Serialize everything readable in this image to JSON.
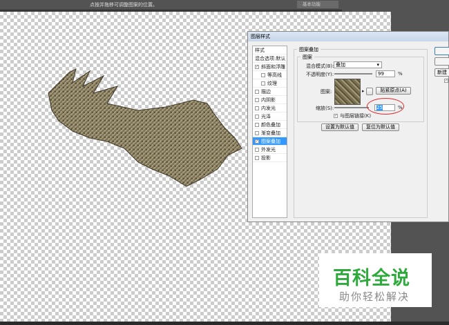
{
  "topbar": {
    "hint": "点按并拖移可调整图案的位置。",
    "workspace": "基本功能"
  },
  "dialog": {
    "title": "图层样式",
    "styles_header": "样式",
    "blend_options": "混合选项:默认",
    "styles": [
      {
        "label": "斜面和浮雕",
        "checked": true,
        "sub": false
      },
      {
        "label": "等高线",
        "checked": false,
        "sub": true
      },
      {
        "label": "纹理",
        "checked": false,
        "sub": true
      },
      {
        "label": "描边",
        "checked": false,
        "sub": false
      },
      {
        "label": "内阴影",
        "checked": false,
        "sub": false
      },
      {
        "label": "内发光",
        "checked": false,
        "sub": false
      },
      {
        "label": "光泽",
        "checked": false,
        "sub": false
      },
      {
        "label": "颜色叠加",
        "checked": false,
        "sub": false
      },
      {
        "label": "渐变叠加",
        "checked": false,
        "sub": false
      },
      {
        "label": "图案叠加",
        "checked": true,
        "sub": false,
        "selected": true
      },
      {
        "label": "外发光",
        "checked": false,
        "sub": false
      },
      {
        "label": "投影",
        "checked": false,
        "sub": false
      }
    ],
    "section_title": "图案叠加",
    "group_title": "图案",
    "blend_mode_label": "混合模式(B):",
    "blend_mode_value": "叠加",
    "opacity_label": "不透明度(Y):",
    "opacity_value": "99",
    "percent": "%",
    "pattern_label": "图案:",
    "snap_origin": "贴紧原点(A)",
    "scale_label": "缩放(S):",
    "scale_value": "25",
    "link_label": "与图层链接(K)",
    "link_checked": true,
    "make_default": "设置为默认值",
    "reset_default": "复位为默认值",
    "right_button_partial": "新建"
  },
  "watermark": {
    "title": "百科全说",
    "subtitle": "助你轻松解决"
  }
}
